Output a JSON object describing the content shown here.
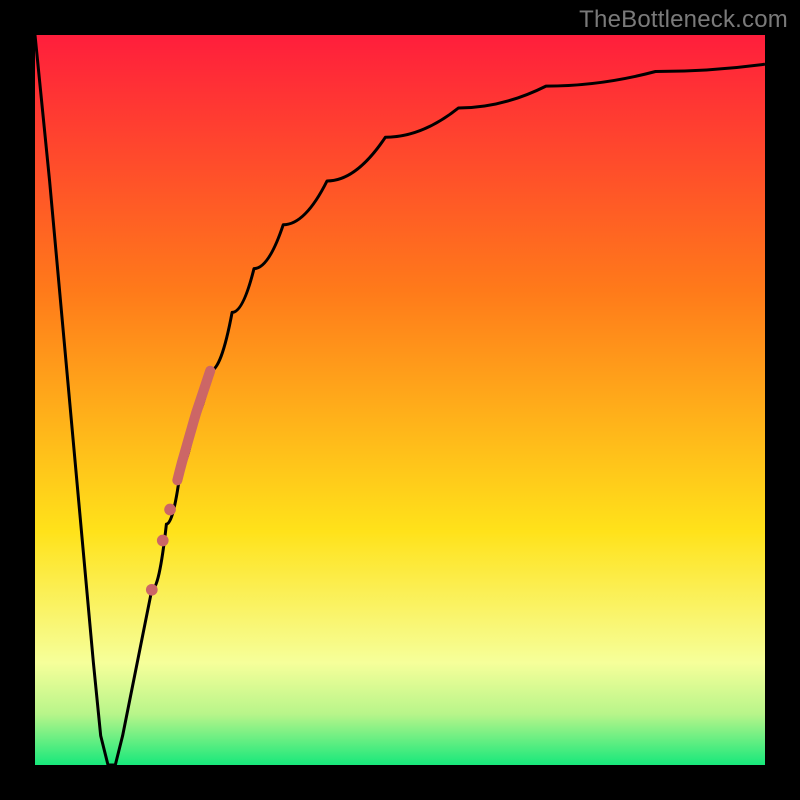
{
  "watermark": "TheBottleneck.com",
  "colors": {
    "frame": "#000000",
    "curve": "#000000",
    "marker": "#cc6666",
    "gradient_top": "#ff1e3c",
    "gradient_mid1": "#ff7a1a",
    "gradient_mid2": "#ffe21a",
    "gradient_bottom_band": "#f6ff9a",
    "gradient_green": "#17e87b"
  },
  "chart_data": {
    "type": "line",
    "title": "",
    "xlabel": "",
    "ylabel": "",
    "xlim": [
      0,
      100
    ],
    "ylim": [
      0,
      100
    ],
    "grid": false,
    "legend": false,
    "series": [
      {
        "name": "bottleneck-curve",
        "x": [
          0,
          2,
          4,
          6,
          8,
          9,
          10,
          11,
          12,
          14,
          16,
          18,
          20,
          22,
          24,
          27,
          30,
          34,
          40,
          48,
          58,
          70,
          85,
          100
        ],
        "y": [
          100,
          80,
          58,
          36,
          14,
          4,
          0,
          0,
          4,
          14,
          24,
          33,
          41,
          48,
          54,
          62,
          68,
          74,
          80,
          86,
          90,
          93,
          95,
          96
        ]
      }
    ],
    "flat_bottom_note": "curve bottoms flat near x≈9.3–10.7 at y≈0",
    "markers": {
      "name": "highlighted-range-on-curve",
      "color": "#cc6666",
      "points": [
        {
          "x": 16.0,
          "y": 24.0,
          "r": 1.0
        },
        {
          "x": 17.5,
          "y": 30.0,
          "r": 1.0
        },
        {
          "x": 18.5,
          "y": 35.0,
          "r": 1.0
        }
      ],
      "thick_segment": {
        "x_start": 19.5,
        "x_end": 24.0,
        "y_start": 39.0,
        "y_end": 54.0,
        "width": 2.5
      }
    },
    "background_gradient": {
      "direction": "vertical",
      "stops": [
        {
          "pos": 0.0,
          "color": "#ff1e3c"
        },
        {
          "pos": 0.35,
          "color": "#ff7a1a"
        },
        {
          "pos": 0.68,
          "color": "#ffe21a"
        },
        {
          "pos": 0.86,
          "color": "#f6ff9a"
        },
        {
          "pos": 0.93,
          "color": "#b8f58a"
        },
        {
          "pos": 1.0,
          "color": "#17e87b"
        }
      ]
    }
  }
}
